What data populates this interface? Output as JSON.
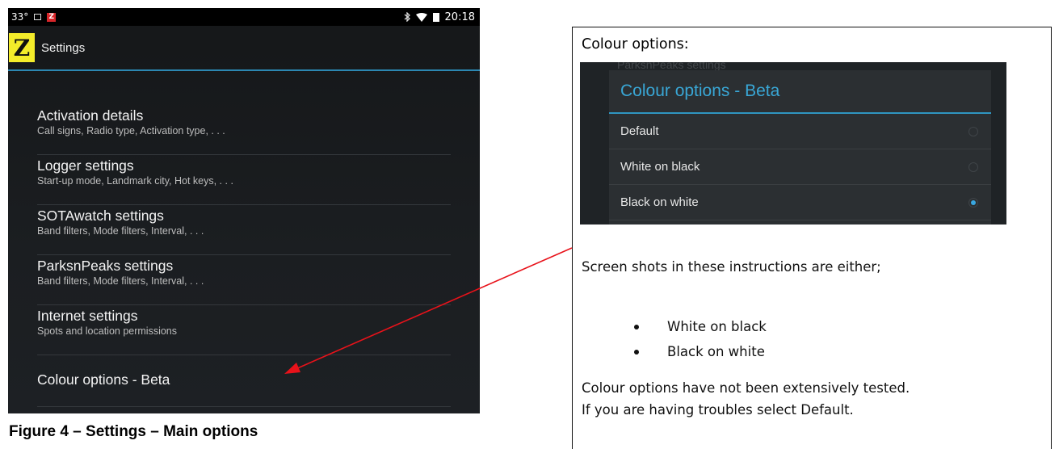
{
  "phone": {
    "status_bar": {
      "temperature": "33°",
      "notification_z": "Z",
      "time": "20:18",
      "icons": [
        "image-icon",
        "app-z-icon",
        "bluetooth-icon",
        "wifi-icon",
        "battery-icon"
      ]
    },
    "action_bar": {
      "app_icon_letter": "Z",
      "title": "Settings"
    },
    "preferences": [
      {
        "title": "Activation details",
        "summary": "Call signs, Radio type, Activation type, . . ."
      },
      {
        "title": "Logger settings",
        "summary": "Start-up mode, Landmark city, Hot keys, . . ."
      },
      {
        "title": "SOTAwatch settings",
        "summary": "Band filters, Mode filters, Interval, . . ."
      },
      {
        "title": "ParksnPeaks settings",
        "summary": "Band filters, Mode filters, Interval, . . ."
      },
      {
        "title": "Internet settings",
        "summary": "Spots and location permissions"
      },
      {
        "title": "Colour options - Beta",
        "summary": ""
      }
    ]
  },
  "caption": "Figure 4 – Settings – Main options",
  "info_box": {
    "heading": "Colour options:",
    "dialog": {
      "ghost_text": "ParksnPeaks settings",
      "title": "Colour options - Beta",
      "options": [
        {
          "label": "Default",
          "selected": false
        },
        {
          "label": "White on black",
          "selected": false
        },
        {
          "label": "Black on white",
          "selected": true
        }
      ],
      "accent_color": "#39a7d6"
    },
    "intro": "Screen shots in these instructions are either;",
    "bullets": [
      "White on black",
      "Black on white"
    ],
    "note_line1": "Colour options have not been extensively tested.",
    "note_line2": "If you are having troubles select Default."
  },
  "colors": {
    "arrow": "#e8121a",
    "action_bar_accent": "#2c87b2",
    "app_icon": "#f4ec2a"
  }
}
